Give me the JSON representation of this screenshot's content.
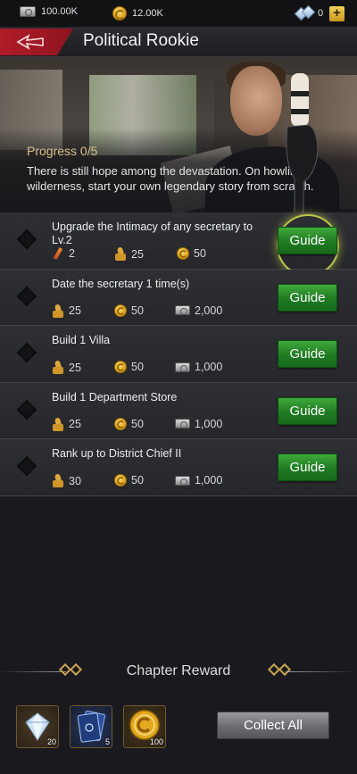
{
  "resources": {
    "cash": "100.00K",
    "coins": "12.00K",
    "diamonds": "0"
  },
  "header": {
    "title": "Political Rookie"
  },
  "banner": {
    "progress": "Progress 0/5",
    "description": "There is still hope among the devastation. On howling wilderness, start your own legendary story from scratch."
  },
  "tasks": [
    {
      "title": "Upgrade the Intimacy of any secretary to Lv.2",
      "rewards": [
        {
          "icon": "syringe-icon",
          "value": "2"
        },
        {
          "icon": "thumb-icon",
          "value": "25"
        },
        {
          "icon": "coin-icon",
          "value": "50"
        }
      ],
      "button": "Guide",
      "highlighted": true
    },
    {
      "title": "Date the secretary 1 time(s)",
      "rewards": [
        {
          "icon": "thumb-icon",
          "value": "25"
        },
        {
          "icon": "coin-icon",
          "value": "50"
        },
        {
          "icon": "cash-icon",
          "value": "2,000"
        }
      ],
      "button": "Guide"
    },
    {
      "title": "Build 1 Villa",
      "rewards": [
        {
          "icon": "thumb-icon",
          "value": "25"
        },
        {
          "icon": "coin-icon",
          "value": "50"
        },
        {
          "icon": "cash-icon",
          "value": "1,000"
        }
      ],
      "button": "Guide"
    },
    {
      "title": "Build 1 Department Store",
      "rewards": [
        {
          "icon": "thumb-icon",
          "value": "25"
        },
        {
          "icon": "coin-icon",
          "value": "50"
        },
        {
          "icon": "cash-icon",
          "value": "1,000"
        }
      ],
      "button": "Guide"
    },
    {
      "title": "Rank up to District Chief II",
      "rewards": [
        {
          "icon": "thumb-icon",
          "value": "30"
        },
        {
          "icon": "coin-icon",
          "value": "50"
        },
        {
          "icon": "cash-icon",
          "value": "1,000"
        }
      ],
      "button": "Guide"
    }
  ],
  "chapter_reward": {
    "title": "Chapter Reward",
    "items": [
      {
        "icon": "diamond-icon",
        "count": "20"
      },
      {
        "icon": "card-icon",
        "count": "5"
      },
      {
        "icon": "gold-coin-icon",
        "count": "100"
      }
    ],
    "collect_label": "Collect All"
  },
  "colors": {
    "accent_red": "#b01c28",
    "guide_green": "#2a8f2c",
    "progress_gold": "#d9c18a"
  }
}
